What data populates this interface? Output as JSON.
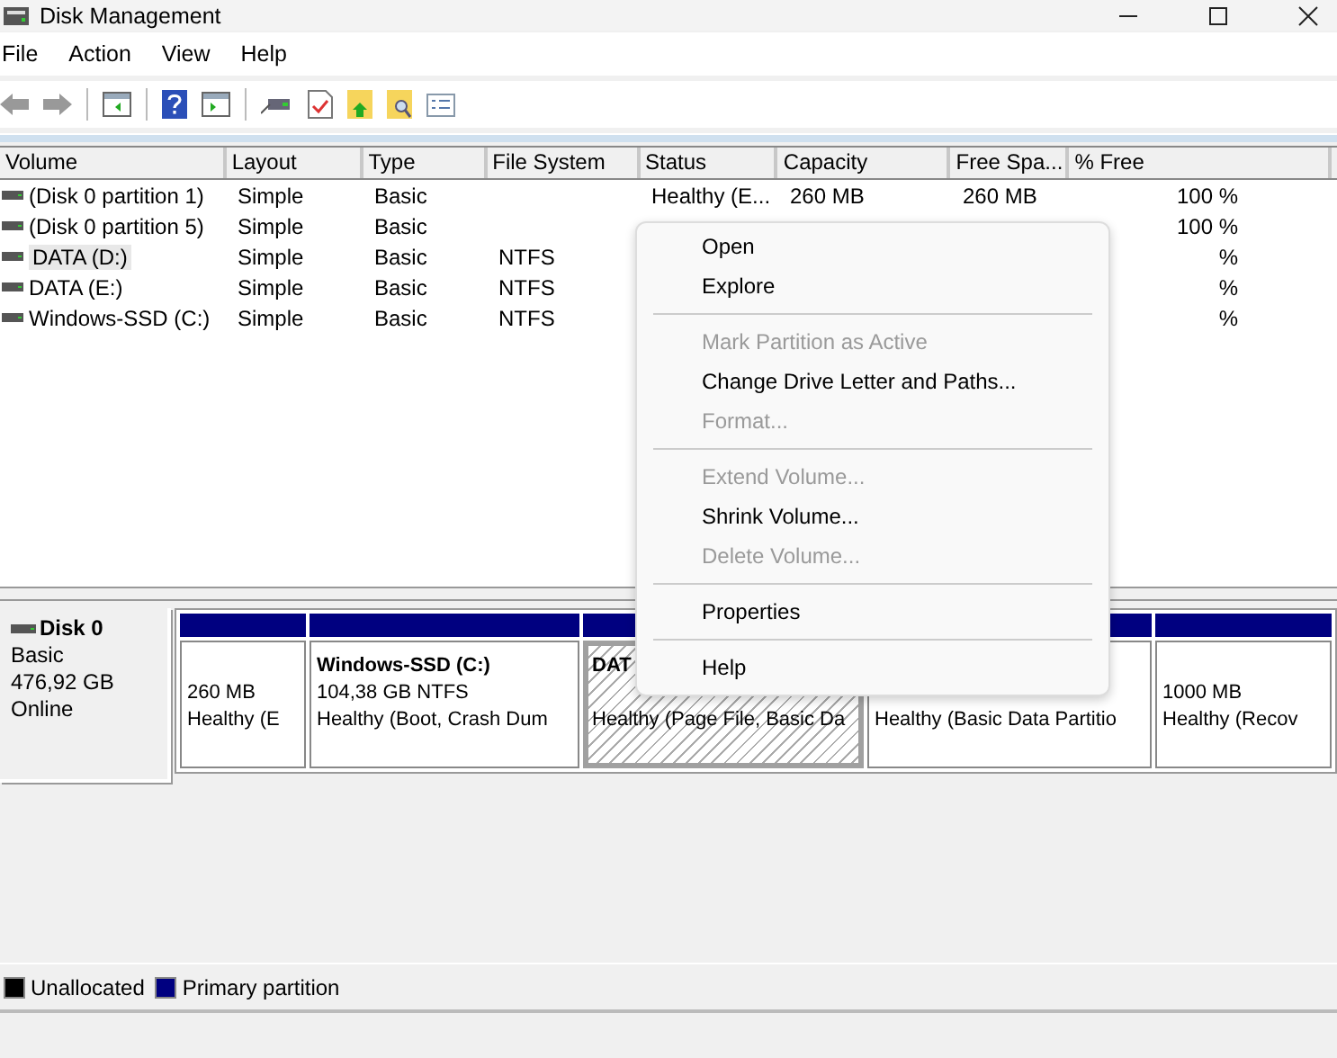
{
  "window": {
    "title": "Disk Management"
  },
  "menu_bar": [
    "File",
    "Action",
    "View",
    "Help"
  ],
  "table": {
    "columns": [
      "Volume",
      "Layout",
      "Type",
      "File System",
      "Status",
      "Capacity",
      "Free Spa...",
      "% Free"
    ],
    "rows": [
      {
        "selected": false,
        "cells": [
          "(Disk 0 partition 1)",
          "Simple",
          "Basic",
          null,
          "Healthy (E...",
          "260 MB",
          "260 MB",
          "100 %"
        ]
      },
      {
        "selected": false,
        "cells": [
          "(Disk 0 partition 5)",
          "Simple",
          "Basic",
          null,
          null,
          null,
          null,
          "100 %"
        ]
      },
      {
        "selected": true,
        "cells": [
          "DATA (D:)",
          "Simple",
          "Basic",
          "NTFS",
          null,
          null,
          null,
          "%"
        ]
      },
      {
        "selected": false,
        "cells": [
          "DATA (E:)",
          "Simple",
          "Basic",
          "NTFS",
          null,
          null,
          null,
          "%"
        ]
      },
      {
        "selected": false,
        "cells": [
          "Windows-SSD (C:)",
          "Simple",
          "Basic",
          "NTFS",
          null,
          null,
          null,
          "%"
        ]
      }
    ]
  },
  "disk_map": {
    "disks": [
      {
        "name": "Disk 0",
        "type": "Basic",
        "size": "476,92 GB",
        "status": "Online",
        "partitions": [
          {
            "size": "260 MB",
            "status": "Healthy (E",
            "selected": false
          },
          {
            "name": "Windows-SSD  (C:)",
            "size": "104,38 GB NTFS",
            "status": "Healthy (Boot, Crash Dum",
            "selected": false
          },
          {
            "name": "DAT",
            "status": "Healthy (Page File, Basic Da",
            "selected": true
          },
          {
            "status": "Healthy (Basic Data Partitio",
            "selected": false
          },
          {
            "size": "1000 MB",
            "status": "Healthy (Recov",
            "selected": false
          }
        ]
      }
    ]
  },
  "legend": [
    {
      "label": "Unallocated",
      "color": "#000000"
    },
    {
      "label": "Primary partition",
      "color": "#000080"
    }
  ],
  "context_menu": {
    "items": [
      {
        "kind": "item",
        "label": "Open",
        "disabled": false
      },
      {
        "kind": "item",
        "label": "Explore",
        "disabled": false
      },
      {
        "kind": "separator"
      },
      {
        "kind": "item",
        "label": "Mark Partition as Active",
        "disabled": true
      },
      {
        "kind": "item",
        "label": "Change Drive Letter and Paths...",
        "disabled": false
      },
      {
        "kind": "item",
        "label": "Format...",
        "disabled": true
      },
      {
        "kind": "separator"
      },
      {
        "kind": "item",
        "label": "Extend Volume...",
        "disabled": true
      },
      {
        "kind": "item",
        "label": "Shrink Volume...",
        "disabled": false
      },
      {
        "kind": "item",
        "label": "Delete Volume...",
        "disabled": true
      },
      {
        "kind": "separator"
      },
      {
        "kind": "item",
        "label": "Properties",
        "disabled": false
      },
      {
        "kind": "separator"
      },
      {
        "kind": "item",
        "label": "Help",
        "disabled": false
      }
    ]
  }
}
